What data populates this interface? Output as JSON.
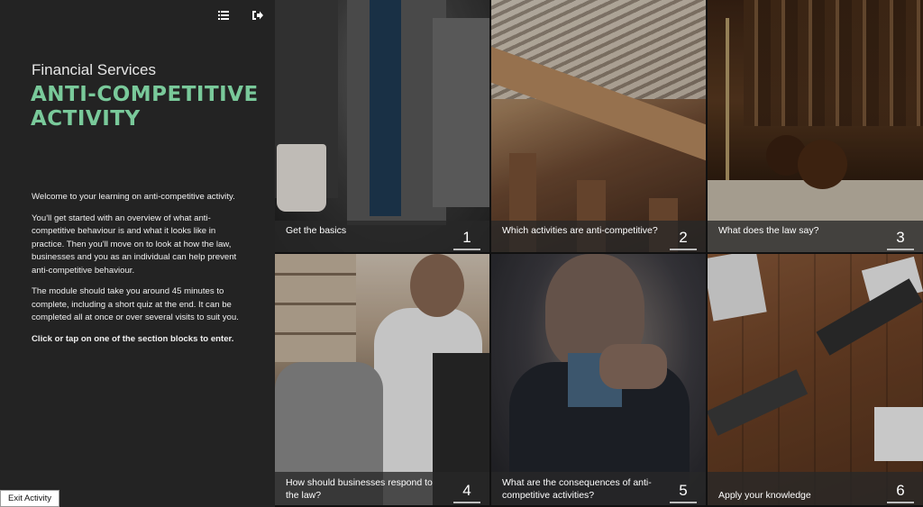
{
  "header": {
    "menu_icon": "list-icon",
    "exit_icon": "sign-out-icon"
  },
  "course": {
    "subtitle": "Financial Services",
    "title_line1": "ANTI-COMPETITIVE",
    "title_line2": "ACTIVITY"
  },
  "intro": {
    "p1": "Welcome to your learning on anti-competitive activity.",
    "p2": "You'll get started with an overview of what anti-competitive behaviour is and what it looks like in practice. Then you'll move on to look at how the law, businesses and you as an individual can help prevent anti-competitive behaviour.",
    "p3": "The module should take you around 45 minutes to complete, including a short quiz at the end. It can be completed all at once or over several visits to suit you.",
    "p4": "Click or tap on one of the section blocks to enter."
  },
  "exit_button": "Exit Activity",
  "sections": [
    {
      "label": "Get the basics",
      "number": "1"
    },
    {
      "label": "Which activities are anti-competitive?",
      "number": "2"
    },
    {
      "label": "What does the law say?",
      "number": "3"
    },
    {
      "label": "How should businesses respond to the law?",
      "number": "4"
    },
    {
      "label": "What are the consequences of anti-competitive activities?",
      "number": "5"
    },
    {
      "label": "Apply your knowledge",
      "number": "6"
    }
  ],
  "colors": {
    "accent": "#79c99a",
    "panel": "#232323"
  }
}
